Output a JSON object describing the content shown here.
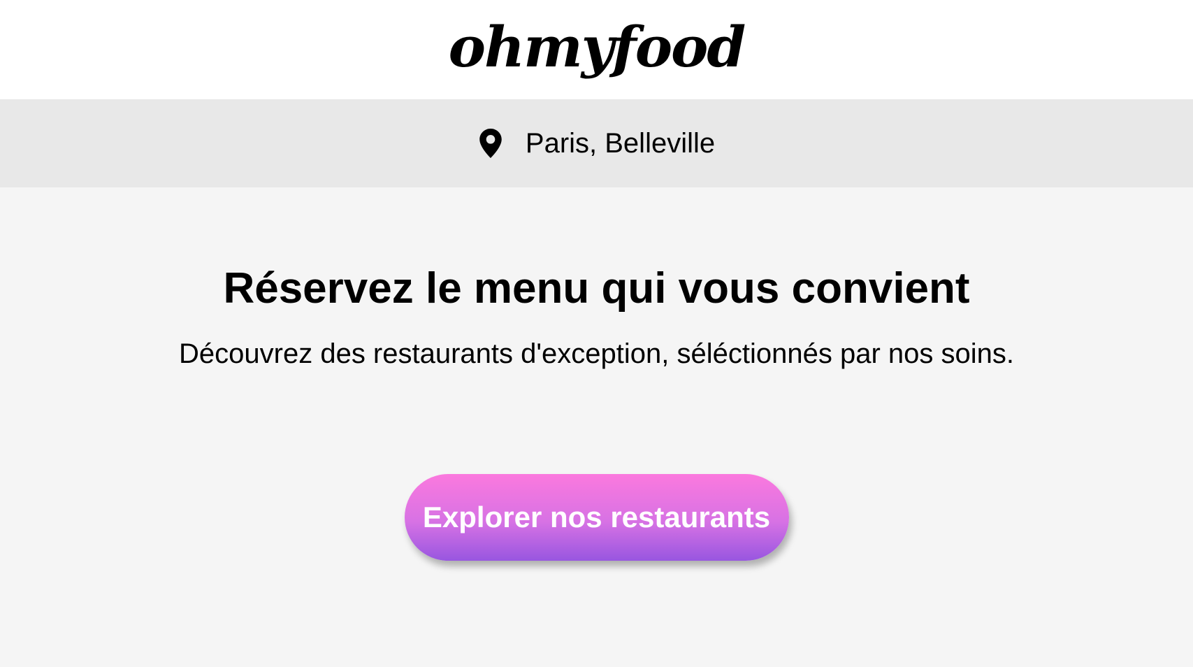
{
  "header": {
    "logo_text": "ohmyfood"
  },
  "location": {
    "icon": "map-pin-icon",
    "text": "Paris, Belleville"
  },
  "hero": {
    "title": "Réservez le menu qui vous convient",
    "subtitle": "Découvrez des restaurants d'exception, séléctionnés par nos soins.",
    "cta_label": "Explorer nos restaurants"
  },
  "colors": {
    "page_background": "#f5f5f5",
    "location_bar_background": "#e8e8e8",
    "button_gradient_top": "#fb79de",
    "button_gradient_bottom": "#9856e0",
    "button_text": "#ffffff"
  }
}
